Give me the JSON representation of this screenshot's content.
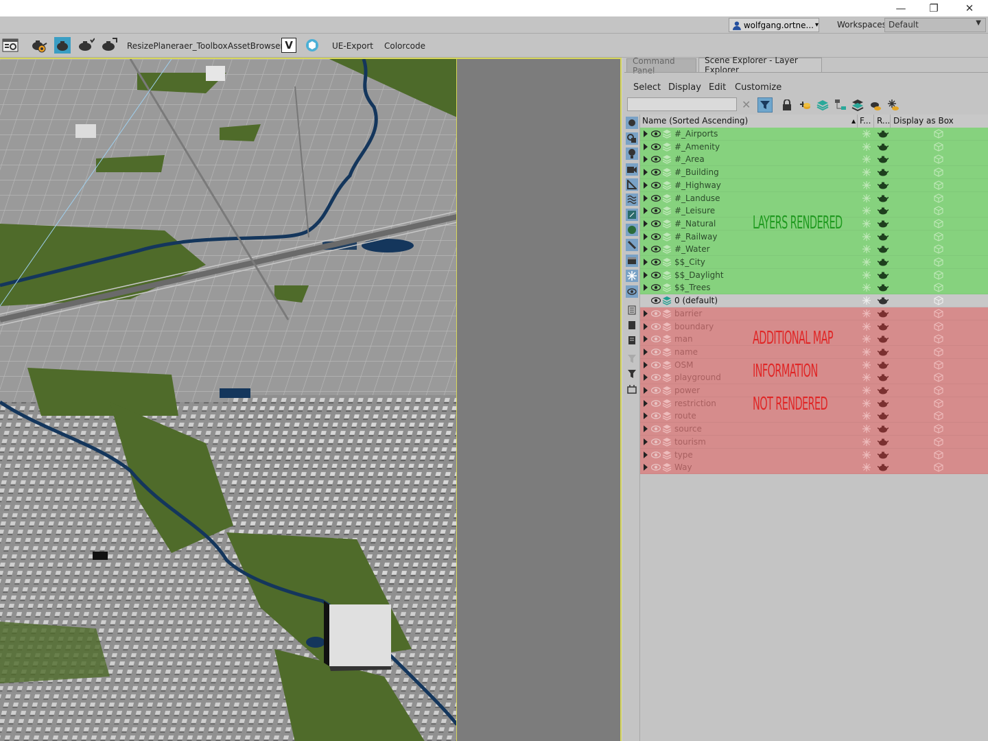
{
  "window": {
    "minimize_glyph": "—",
    "restore_glyph": "❐",
    "close_glyph": "✕"
  },
  "userbar": {
    "user_name": "wolfgang.ortne...",
    "user_caret": "▾",
    "workspaces_label": "Workspaces:",
    "workspace_value": "Default",
    "workspace_caret": "▼"
  },
  "toolbar": {
    "icons": [
      "scene-grid-icon",
      "teapot-gear-icon",
      "teapot-frame-icon",
      "teapot-check-icon",
      "teapot-arrow-icon"
    ],
    "labels": [
      "ResizePlane",
      "raer_Toolbox",
      "AssetBrowser",
      "UE-Export",
      "Colorcode"
    ],
    "v_badge": "V"
  },
  "panel": {
    "tabs": [
      "Command Panel",
      "Scene Explorer - Layer Explorer"
    ],
    "menu": [
      "Select",
      "Display",
      "Edit",
      "Customize"
    ],
    "search_value": "",
    "search_clear_glyph": "✕",
    "header": {
      "name": "Name (Sorted Ascending)",
      "sort_glyph": "▲",
      "frozen": "F...",
      "render": "R...",
      "display": "Display as Box"
    }
  },
  "layers_rendered": [
    "#_Airports",
    "#_Amenity",
    "#_Area",
    "#_Building",
    "#_Highway",
    "#_Landuse",
    "#_Leisure",
    "#_Natural",
    "#_Railway",
    "#_Water",
    "$$_City",
    "$$_Daylight",
    "$$_Trees"
  ],
  "layer_default": "0 (default)",
  "layers_not_rendered": [
    "barrier",
    "boundary",
    "man",
    "name",
    "OSM",
    "playground",
    "power",
    "restriction",
    "route",
    "source",
    "tourism",
    "type",
    "Way"
  ],
  "annotations": {
    "rendered": "LAYERS RENDERED",
    "not_rendered_1": "ADDITIONAL MAP",
    "not_rendered_2": "INFORMATION",
    "not_rendered_3": "NOT RENDERED"
  },
  "colors": {
    "rendered_row": "#86d27e",
    "not_rendered_row": "#d68c8c",
    "selected_row": "#c8c8c8",
    "viewport_border": "#d8d85a",
    "annotation_green": "#1f9a1f",
    "annotation_red": "#e02626"
  }
}
